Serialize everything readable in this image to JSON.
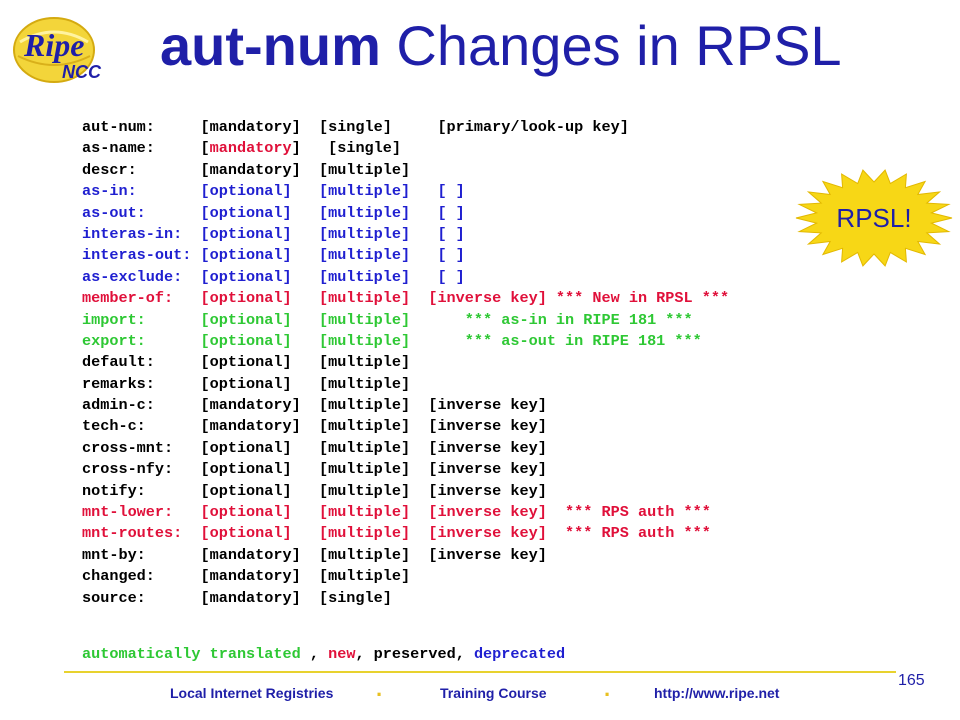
{
  "logo": {
    "text_main": "Ripe",
    "text_sub": "NCC"
  },
  "title": {
    "bold": "aut-num",
    "rest": " Changes in RPSL"
  },
  "rows": [
    {
      "color": "black",
      "text": "aut-num:     [mandatory]  [single]     [primary/look-up key]"
    },
    {
      "color": "black",
      "segments": [
        {
          "color": "black",
          "text": "as-name:     ["
        },
        {
          "color": "red",
          "text": "mandatory"
        },
        {
          "color": "black",
          "text": "]   [single]"
        }
      ]
    },
    {
      "color": "black",
      "text": "descr:       [mandatory]  [multiple]"
    },
    {
      "color": "blue",
      "text": "as-in:       [optional]   [multiple]   [ ]"
    },
    {
      "color": "blue",
      "text": "as-out:      [optional]   [multiple]   [ ]"
    },
    {
      "color": "blue",
      "text": "interas-in:  [optional]   [multiple]   [ ]"
    },
    {
      "color": "blue",
      "text": "interas-out: [optional]   [multiple]   [ ]"
    },
    {
      "color": "blue",
      "text": "as-exclude:  [optional]   [multiple]   [ ]"
    },
    {
      "color": "red",
      "text": "member-of:   [optional]   [multiple]  [inverse key] *** New in RPSL ***"
    },
    {
      "color": "green",
      "text": "import:      [optional]   [multiple]      *** as-in in RIPE 181 ***"
    },
    {
      "color": "green",
      "text": "export:      [optional]   [multiple]      *** as-out in RIPE 181 ***"
    },
    {
      "color": "black",
      "text": "default:     [optional]   [multiple]"
    },
    {
      "color": "black",
      "text": "remarks:     [optional]   [multiple]"
    },
    {
      "color": "black",
      "text": "admin-c:     [mandatory]  [multiple]  [inverse key]"
    },
    {
      "color": "black",
      "text": "tech-c:      [mandatory]  [multiple]  [inverse key]"
    },
    {
      "color": "black",
      "text": "cross-mnt:   [optional]   [multiple]  [inverse key]"
    },
    {
      "color": "black",
      "text": "cross-nfy:   [optional]   [multiple]  [inverse key]"
    },
    {
      "color": "black",
      "text": "notify:      [optional]   [multiple]  [inverse key]"
    },
    {
      "color": "red",
      "text": "mnt-lower:   [optional]   [multiple]  [inverse key]  *** RPS auth ***"
    },
    {
      "color": "red",
      "text": "mnt-routes:  [optional]   [multiple]  [inverse key]  *** RPS auth ***"
    },
    {
      "color": "black",
      "text": "mnt-by:      [mandatory]  [multiple]  [inverse key]"
    },
    {
      "color": "black",
      "text": "changed:     [mandatory]  [multiple]"
    },
    {
      "color": "black",
      "text": "source:      [mandatory]  [single]"
    }
  ],
  "legend": {
    "translated": "automatically translated",
    "sep1": " , ",
    "new": "new",
    "sep2": ", ",
    "preserved": "preserved",
    "sep3": ", ",
    "deprecated": "deprecated"
  },
  "burst": {
    "label": "RPSL!"
  },
  "footer": {
    "left": "Local Internet Registries",
    "middle": "Training Course",
    "right": "http://www.ripe.net",
    "separator": ".",
    "page_number": "165"
  },
  "colors": {
    "title": "#1f1fa8",
    "black": "#000000",
    "blue": "#1f1fd0",
    "red": "#e0103a",
    "green": "#2ec834",
    "burst_fill": "#f7d716",
    "footer_line": "#e8d22e"
  }
}
